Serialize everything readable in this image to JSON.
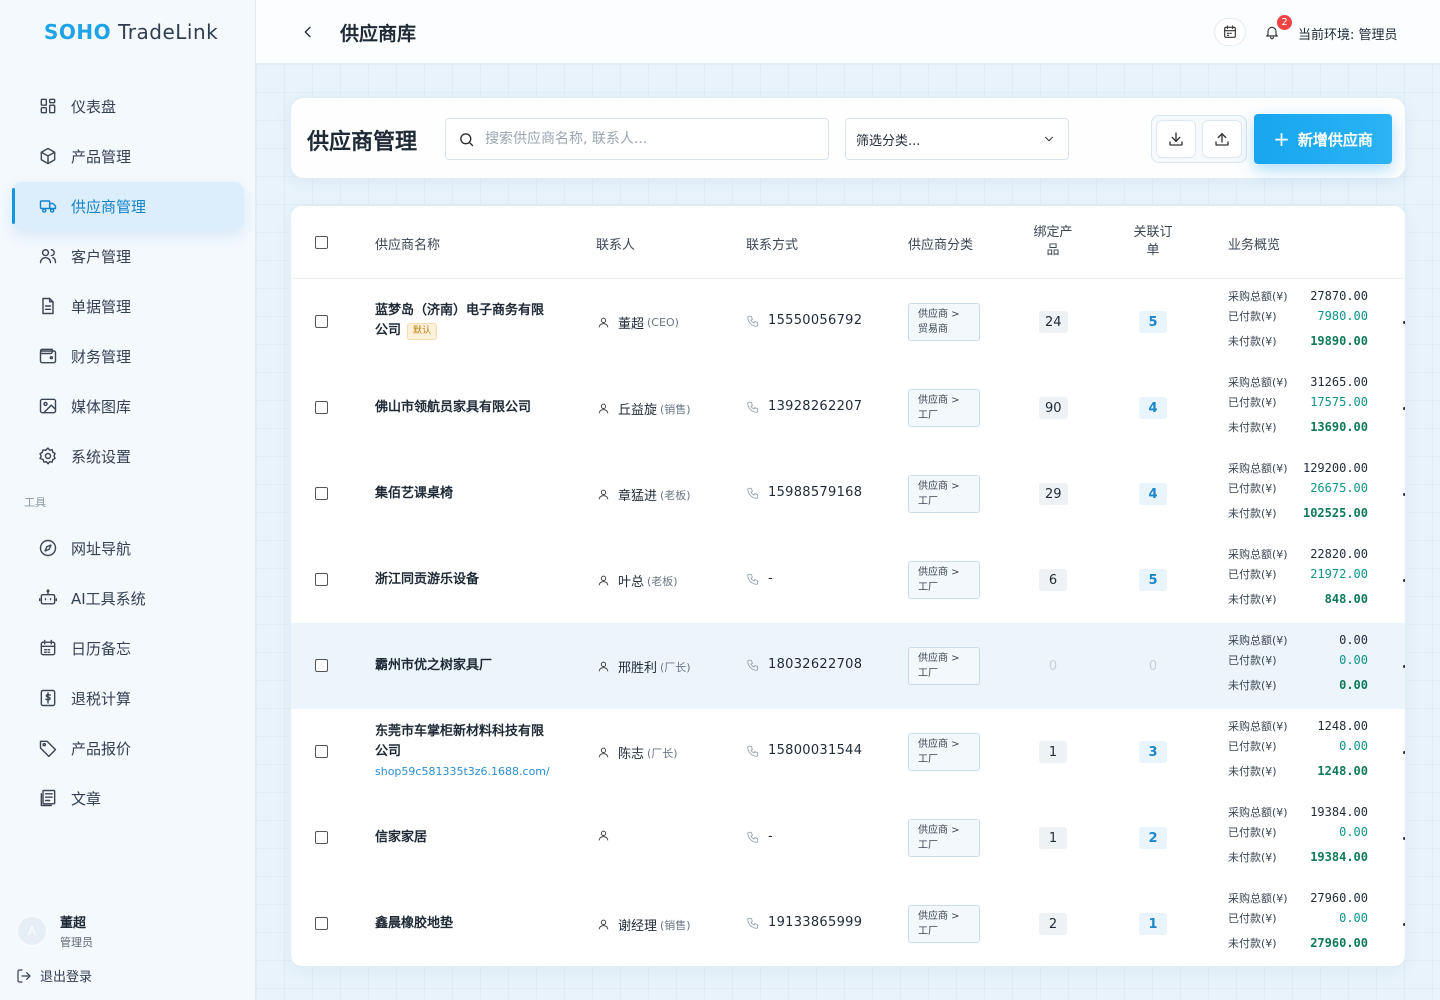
{
  "app": {
    "brand": "SOHO",
    "name": "TradeLink"
  },
  "sidebar": {
    "items": [
      {
        "label": "仪表盘",
        "icon": "dashboard-icon"
      },
      {
        "label": "产品管理",
        "icon": "box-icon"
      },
      {
        "label": "供应商管理",
        "icon": "truck-icon",
        "active": true
      },
      {
        "label": "客户管理",
        "icon": "users-icon"
      },
      {
        "label": "单据管理",
        "icon": "document-icon"
      },
      {
        "label": "财务管理",
        "icon": "wallet-icon"
      },
      {
        "label": "媒体图库",
        "icon": "image-icon"
      },
      {
        "label": "系统设置",
        "icon": "gear-icon"
      }
    ],
    "tools_section": "工具",
    "tools": [
      {
        "label": "网址导航",
        "icon": "compass-icon"
      },
      {
        "label": "AI工具系统",
        "icon": "bot-icon"
      },
      {
        "label": "日历备忘",
        "icon": "calendar-icon"
      },
      {
        "label": "退税计算",
        "icon": "calculator-icon"
      },
      {
        "label": "产品报价",
        "icon": "tag-icon"
      },
      {
        "label": "文章",
        "icon": "article-icon"
      }
    ],
    "user": {
      "avatar": "A",
      "name": "董超",
      "role": "管理员"
    },
    "logout": "退出登录"
  },
  "header": {
    "title": "供应商库",
    "notification_count": "2",
    "env_label": "当前环境: 管理员"
  },
  "toolbar": {
    "title": "供应商管理",
    "search_placeholder": "搜索供应商名称, 联系人...",
    "filter_label": "筛选分类...",
    "add_label": "新增供应商"
  },
  "table": {
    "columns": {
      "name": "供应商名称",
      "contact": "联系人",
      "phone": "联系方式",
      "category": "供应商分类",
      "products": "绑定产品",
      "orders": "关联订单",
      "overview": "业务概览"
    },
    "fin_labels": {
      "total": "采购总额(¥)",
      "paid": "已付款(¥)",
      "unpaid": "未付款(¥)"
    },
    "default_tag": "默认",
    "rows": [
      {
        "name": "蓝梦岛（济南）电子商务有限公司",
        "is_default": true,
        "link": "",
        "contact": "董超",
        "role": "(CEO)",
        "phone": "15550056792",
        "cat1": "供应商 >",
        "cat2": "贸易商",
        "products": "24",
        "orders": "5",
        "total": "27870.00",
        "paid": "7980.00",
        "unpaid": "19890.00"
      },
      {
        "name": "佛山市领航员家具有限公司",
        "is_default": false,
        "link": "",
        "contact": "丘益旋",
        "role": "(销售)",
        "phone": "13928262207",
        "cat1": "供应商 >",
        "cat2": "工厂",
        "products": "90",
        "orders": "4",
        "total": "31265.00",
        "paid": "17575.00",
        "unpaid": "13690.00"
      },
      {
        "name": "集佰艺课桌椅",
        "is_default": false,
        "link": "",
        "contact": "章猛进",
        "role": "(老板)",
        "phone": "15988579168",
        "cat1": "供应商 >",
        "cat2": "工厂",
        "products": "29",
        "orders": "4",
        "total": "129200.00",
        "paid": "26675.00",
        "unpaid": "102525.00"
      },
      {
        "name": "浙江同贡游乐设备",
        "is_default": false,
        "link": "",
        "contact": "叶总",
        "role": "(老板)",
        "phone": "-",
        "cat1": "供应商 >",
        "cat2": "工厂",
        "products": "6",
        "orders": "5",
        "total": "22820.00",
        "paid": "21972.00",
        "unpaid": "848.00"
      },
      {
        "name": "霸州市优之树家具厂",
        "is_default": false,
        "link": "",
        "contact": "邢胜利",
        "role": "(厂长)",
        "phone": "18032622708",
        "cat1": "供应商 >",
        "cat2": "工厂",
        "products": "0",
        "orders": "0",
        "total": "0.00",
        "paid": "0.00",
        "unpaid": "0.00",
        "highlight": true
      },
      {
        "name": "东莞市车掌柜新材料科技有限公司",
        "is_default": false,
        "link": "shop59c581335t3z6.1688.com/",
        "contact": "陈志",
        "role": "(厂长)",
        "phone": "15800031544",
        "cat1": "供应商 >",
        "cat2": "工厂",
        "products": "1",
        "orders": "3",
        "total": "1248.00",
        "paid": "0.00",
        "unpaid": "1248.00"
      },
      {
        "name": "信家家居",
        "is_default": false,
        "link": "",
        "contact": "",
        "role": "",
        "phone": "-",
        "cat1": "供应商 >",
        "cat2": "工厂",
        "products": "1",
        "orders": "2",
        "total": "19384.00",
        "paid": "0.00",
        "unpaid": "19384.00"
      },
      {
        "name": "鑫晨橡胶地垫",
        "is_default": false,
        "link": "",
        "contact": "谢经理",
        "role": "(销售)",
        "phone": "19133865999",
        "cat1": "供应商 >",
        "cat2": "工厂",
        "products": "2",
        "orders": "1",
        "total": "27960.00",
        "paid": "0.00",
        "unpaid": "27960.00"
      }
    ]
  }
}
